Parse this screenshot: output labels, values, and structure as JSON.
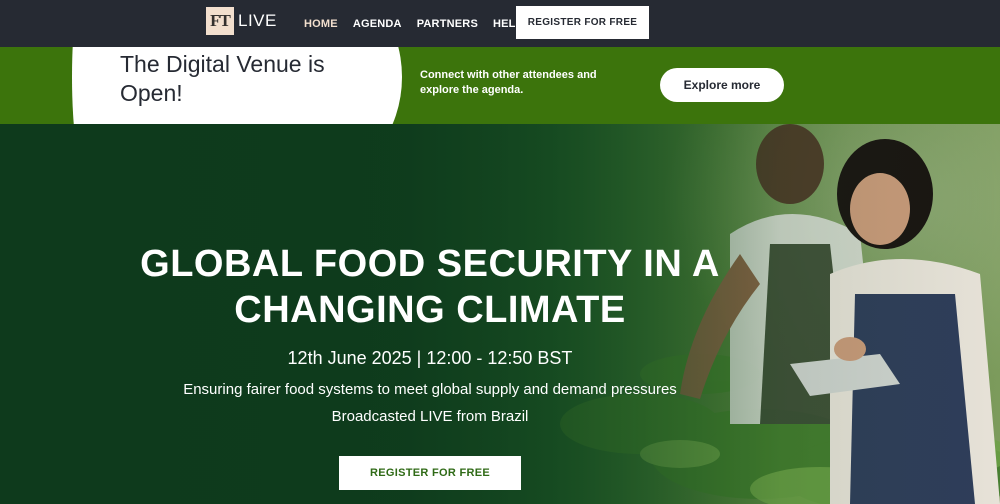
{
  "nav": {
    "logo_ft": "FT",
    "logo_live": "LIVE",
    "links": [
      "HOME",
      "AGENDA",
      "PARTNERS",
      "HELP"
    ],
    "active_link": "HOME",
    "register_label": "REGISTER FOR FREE"
  },
  "venue_banner": {
    "title": "The Digital Venue is Open!",
    "text": "Connect with other attendees and explore the agenda.",
    "button_label": "Explore more"
  },
  "hero": {
    "title": "GLOBAL FOOD SECURITY IN A CHANGING CLIMATE",
    "date": "12th June 2025 | 12:00 - 12:50 BST",
    "subtitle": "Ensuring fairer food systems to meet global supply and demand pressures",
    "broadcast": "Broadcasted LIVE from Brazil",
    "register_label": "REGISTER FOR FREE"
  },
  "colors": {
    "nav_bg": "#262a33",
    "banner_green": "#3c740c",
    "hero_green": "#0f3a1c",
    "ft_pink": "#f2dfce"
  }
}
